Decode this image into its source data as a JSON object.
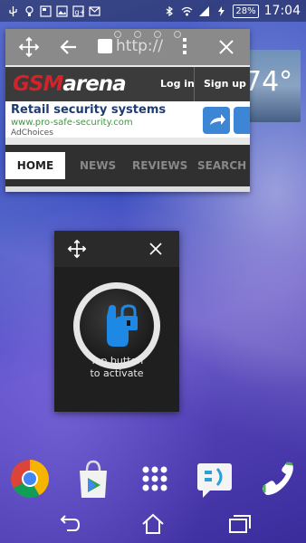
{
  "status_bar": {
    "battery": "28%",
    "time": "17:04"
  },
  "weather": {
    "temp": "74°"
  },
  "browser": {
    "url_text": "http://",
    "gsmarena": {
      "logo_left": "GSM",
      "logo_right": "arena",
      "login": "Log in",
      "signup": "Sign up"
    },
    "ad": {
      "title": "Retail security systems",
      "url": "www.pro-safe-security.com",
      "choices": "AdChoices"
    },
    "nav": {
      "home": "HOME",
      "news": "NEWS",
      "reviews": "REVIEWS",
      "search": "SEARCH"
    }
  },
  "lock_widget": {
    "label_line1": "Tap button",
    "label_line2": "to activate"
  },
  "dock_apps": [
    "chrome-icon",
    "play-store-icon",
    "app-drawer-icon",
    "messaging-icon",
    "phone-icon"
  ],
  "colors": {
    "gsm_red": "#d2222a",
    "accent_blue": "#3d86d6",
    "lock_blue": "#1e88e5"
  }
}
